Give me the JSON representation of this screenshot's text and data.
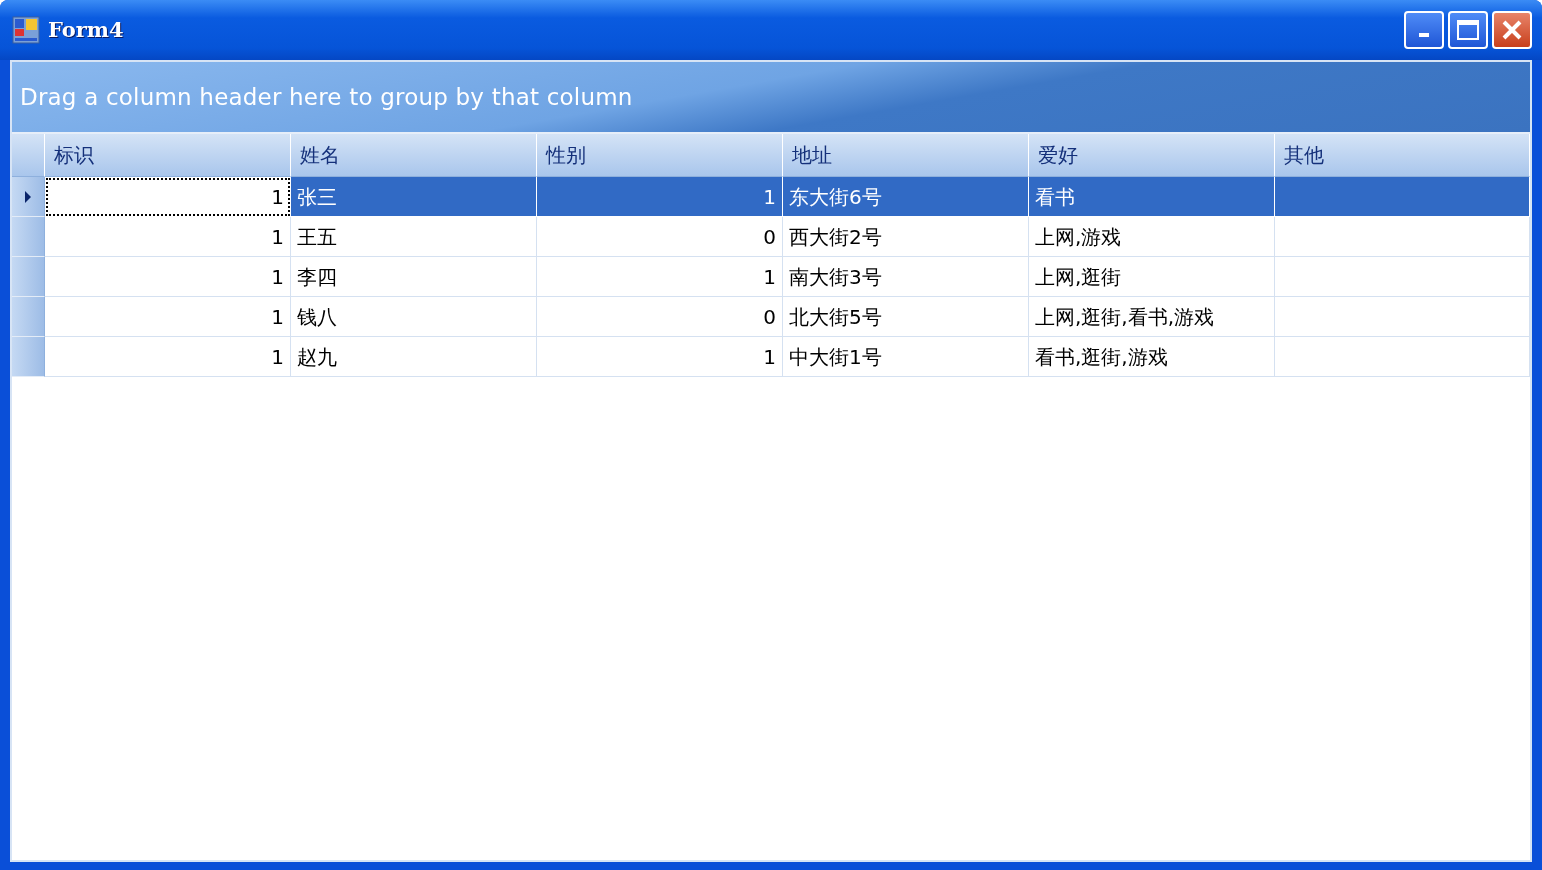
{
  "window": {
    "title": "Form4"
  },
  "group_panel": {
    "hint": "Drag a column header here to group by that column"
  },
  "table": {
    "columns": [
      {
        "label": "标识",
        "kind": "number"
      },
      {
        "label": "姓名",
        "kind": "text"
      },
      {
        "label": "性别",
        "kind": "number"
      },
      {
        "label": "地址",
        "kind": "text"
      },
      {
        "label": "爱好",
        "kind": "text"
      },
      {
        "label": "其他",
        "kind": "text"
      }
    ],
    "rows": [
      {
        "selected": true,
        "cells": [
          "1",
          "张三",
          "1",
          "东大街6号",
          "看书",
          ""
        ]
      },
      {
        "selected": false,
        "cells": [
          "1",
          "王五",
          "0",
          "西大街2号",
          "上网,游戏",
          ""
        ]
      },
      {
        "selected": false,
        "cells": [
          "1",
          "李四",
          "1",
          "南大街3号",
          "上网,逛街",
          ""
        ]
      },
      {
        "selected": false,
        "cells": [
          "1",
          "钱八",
          "0",
          "北大街5号",
          "上网,逛街,看书,游戏",
          ""
        ]
      },
      {
        "selected": false,
        "cells": [
          "1",
          "赵九",
          "1",
          "中大街1号",
          "看书,逛街,游戏",
          ""
        ]
      }
    ]
  }
}
